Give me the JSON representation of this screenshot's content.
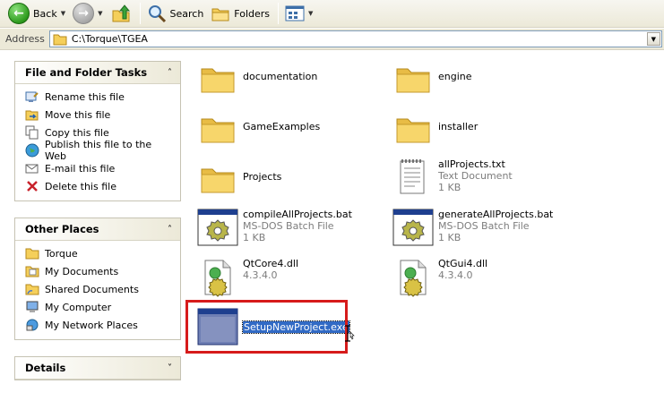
{
  "toolbar": {
    "back_label": "Back",
    "search_label": "Search",
    "folders_label": "Folders"
  },
  "address": {
    "label": "Address",
    "value": "C:\\Torque\\TGEA"
  },
  "tasks_panel": {
    "title": "File and Folder Tasks",
    "items": [
      {
        "label": "Rename this file",
        "icon": "rename-icon"
      },
      {
        "label": "Move this file",
        "icon": "move-icon"
      },
      {
        "label": "Copy this file",
        "icon": "copy-icon"
      },
      {
        "label": "Publish this file to the Web",
        "icon": "publish-web-icon"
      },
      {
        "label": "E-mail this file",
        "icon": "email-icon"
      },
      {
        "label": "Delete this file",
        "icon": "delete-icon"
      }
    ]
  },
  "places_panel": {
    "title": "Other Places",
    "items": [
      {
        "label": "Torque",
        "icon": "folder-icon"
      },
      {
        "label": "My Documents",
        "icon": "my-documents-icon"
      },
      {
        "label": "Shared Documents",
        "icon": "shared-documents-icon"
      },
      {
        "label": "My Computer",
        "icon": "my-computer-icon"
      },
      {
        "label": "My Network Places",
        "icon": "network-places-icon"
      }
    ]
  },
  "details_panel": {
    "title": "Details"
  },
  "files": [
    {
      "name": "documentation",
      "type": "folder"
    },
    {
      "name": "engine",
      "type": "folder"
    },
    {
      "name": "GameExamples",
      "type": "folder"
    },
    {
      "name": "installer",
      "type": "folder"
    },
    {
      "name": "Projects",
      "type": "folder"
    },
    {
      "name": "allProjects.txt",
      "type": "text",
      "line2": "Text Document",
      "line3": "1 KB"
    },
    {
      "name": "compileAllProjects.bat",
      "type": "batch",
      "line2": "MS-DOS Batch File",
      "line3": "1 KB"
    },
    {
      "name": "generateAllProjects.bat",
      "type": "batch",
      "line2": "MS-DOS Batch File",
      "line3": "1 KB"
    },
    {
      "name": "QtCore4.dll",
      "type": "dll",
      "line2": "4.3.4.0"
    },
    {
      "name": "QtGui4.dll",
      "type": "dll",
      "line2": "4.3.4.0"
    },
    {
      "name": "SetupNewProject.exe",
      "type": "exe",
      "selected": true
    }
  ],
  "colors": {
    "selection": "#316ac5",
    "highlight_border": "#d61b1b",
    "folder_yellow": "#f7d66b"
  }
}
